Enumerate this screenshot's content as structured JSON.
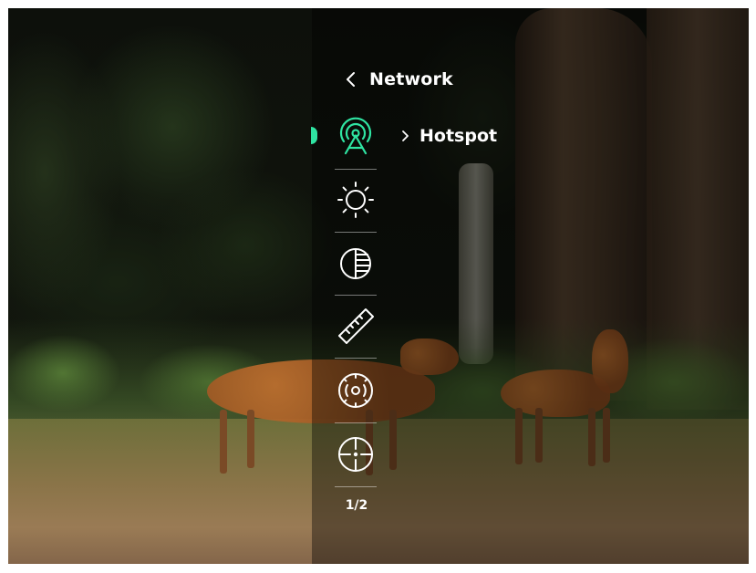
{
  "menu": {
    "title": "Network",
    "accent_color": "#2fe4a2",
    "selected_index": 0,
    "items": [
      {
        "icon": "network-icon",
        "selected": true
      },
      {
        "icon": "brightness-icon",
        "selected": false
      },
      {
        "icon": "contrast-icon",
        "selected": false
      },
      {
        "icon": "ruler-icon",
        "selected": false
      },
      {
        "icon": "calibration-icon",
        "selected": false
      },
      {
        "icon": "reticle-icon",
        "selected": false
      }
    ],
    "submenu_label": "Hotspot",
    "page_indicator": "1/2"
  }
}
